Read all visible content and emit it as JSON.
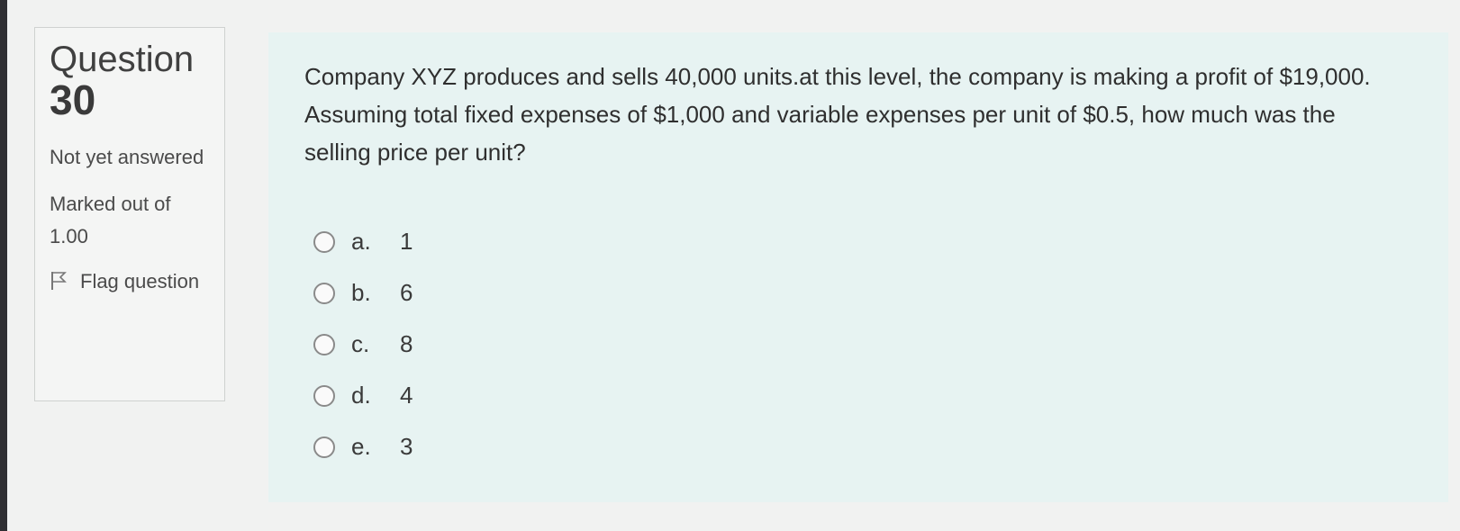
{
  "question": {
    "word": "Question",
    "number": "30",
    "status": "Not yet answered",
    "marks_label": "Marked out of",
    "marks_value": "1.00",
    "flag_label": "Flag question"
  },
  "content": {
    "text": "Company XYZ produces and sells 40,000 units.at this level, the company is making a profit of $19,000. Assuming total fixed expenses of $1,000 and variable expenses per unit of $0.5, how much was the selling price per unit?",
    "options": [
      {
        "letter": "a.",
        "value": "1"
      },
      {
        "letter": "b.",
        "value": "6"
      },
      {
        "letter": "c.",
        "value": "8"
      },
      {
        "letter": "d.",
        "value": "4"
      },
      {
        "letter": "e.",
        "value": "3"
      }
    ]
  },
  "colors": {
    "content_bg": "#e7f3f2",
    "info_bg": "#f4f5f4",
    "text": "#3a3a3a"
  },
  "icons": {
    "flag": "flag-icon",
    "radio": "radio-icon"
  }
}
